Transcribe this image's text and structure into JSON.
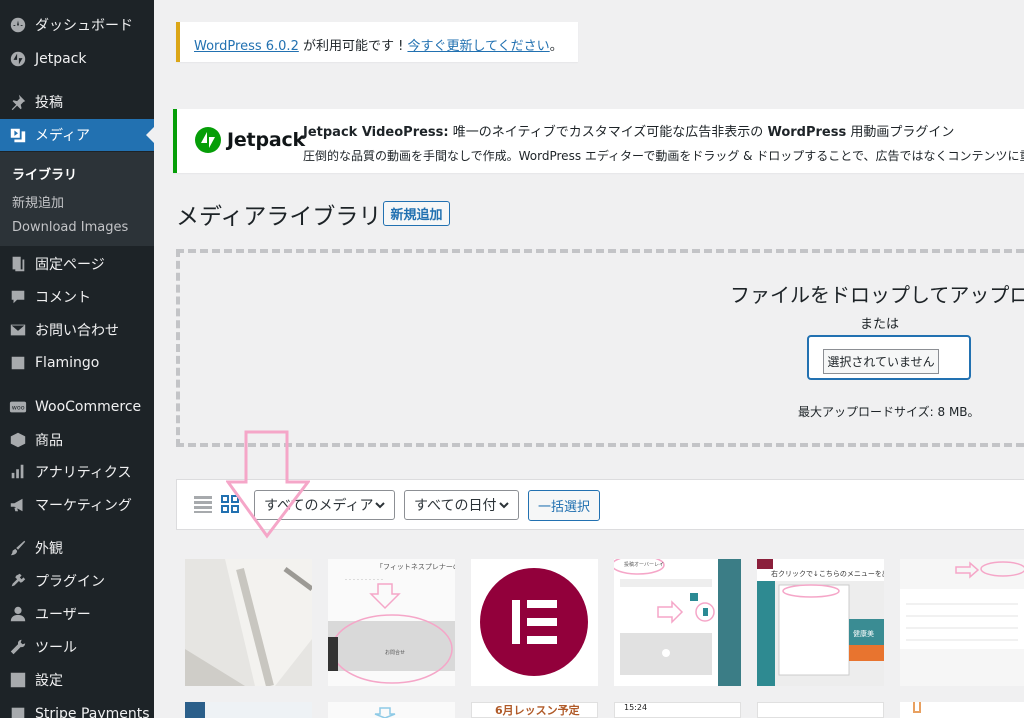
{
  "sidebar": {
    "items": [
      {
        "label": "ダッシュボード",
        "icon": "dashboard-icon"
      },
      {
        "label": "Jetpack",
        "icon": "jetpack-icon"
      },
      {
        "label": "投稿",
        "icon": "pin-icon"
      },
      {
        "label": "メディア",
        "icon": "media-icon"
      },
      {
        "label": "固定ページ",
        "icon": "page-icon"
      },
      {
        "label": "コメント",
        "icon": "comment-icon"
      },
      {
        "label": "お問い合わせ",
        "icon": "mail-icon"
      },
      {
        "label": "Flamingo",
        "icon": "flamingo-icon"
      },
      {
        "label": "WooCommerce",
        "icon": "woo-icon"
      },
      {
        "label": "商品",
        "icon": "box-icon"
      },
      {
        "label": "アナリティクス",
        "icon": "bar-chart-icon"
      },
      {
        "label": "マーケティング",
        "icon": "megaphone-icon"
      },
      {
        "label": "外観",
        "icon": "brush-icon"
      },
      {
        "label": "プラグイン",
        "icon": "plug-icon"
      },
      {
        "label": "ユーザー",
        "icon": "user-icon"
      },
      {
        "label": "ツール",
        "icon": "wrench-icon"
      },
      {
        "label": "設定",
        "icon": "settings-icon"
      },
      {
        "label": "Stripe Payments",
        "icon": "stripe-icon"
      }
    ],
    "submenu": [
      "ライブラリ",
      "新規追加",
      "Download Images"
    ]
  },
  "update_notice": {
    "link1": "WordPress 6.0.2",
    "middle": " が利用可能です ! ",
    "link2": "今すぐ更新してください",
    "end": "。"
  },
  "jetpack_notice": {
    "logo_text": "Jetpack",
    "title_bold": "Jetpack VideoPress:",
    "title_rest": " 唯一のネイティブでカスタマイズ可能な広告非表示の ",
    "title_bold2": "WordPress",
    "title_end": " 用動画プラグイン",
    "description": "圧倒的な品質の動画を手間なしで作成。WordPress エディターで動画をドラッグ & ドロップすることで、広告ではなくコンテンツに重点を置"
  },
  "page": {
    "title": "メディアライブラリ",
    "add_new": "新規追加"
  },
  "uploader": {
    "drop_title": "ファイルをドロップしてアップロー",
    "or": "または",
    "file_button": "選択されていません",
    "max_size": "最大アップロードサイズ: 8 MB。"
  },
  "toolbar": {
    "media_filter": "すべてのメディア",
    "date_filter": "すべての日付",
    "bulk_select": "一括選択"
  },
  "thumbs": {
    "t2_caption": "「フィットネスプレナーの日",
    "t2_button": "お問合せ",
    "t4_label": "投稿オーバーレイ",
    "t5_banner": "右クリックで↓こちらのメニューを出",
    "t5_side": "健康美",
    "r2_text1": "6月レッスン予定",
    "r2_time": "15:24"
  },
  "colors": {
    "sidebar_bg": "#1d2327",
    "accent": "#2271b1",
    "jetpack_green": "#069e08",
    "elementor": "#92003b",
    "annotation_pink": "#f5a6c8"
  }
}
